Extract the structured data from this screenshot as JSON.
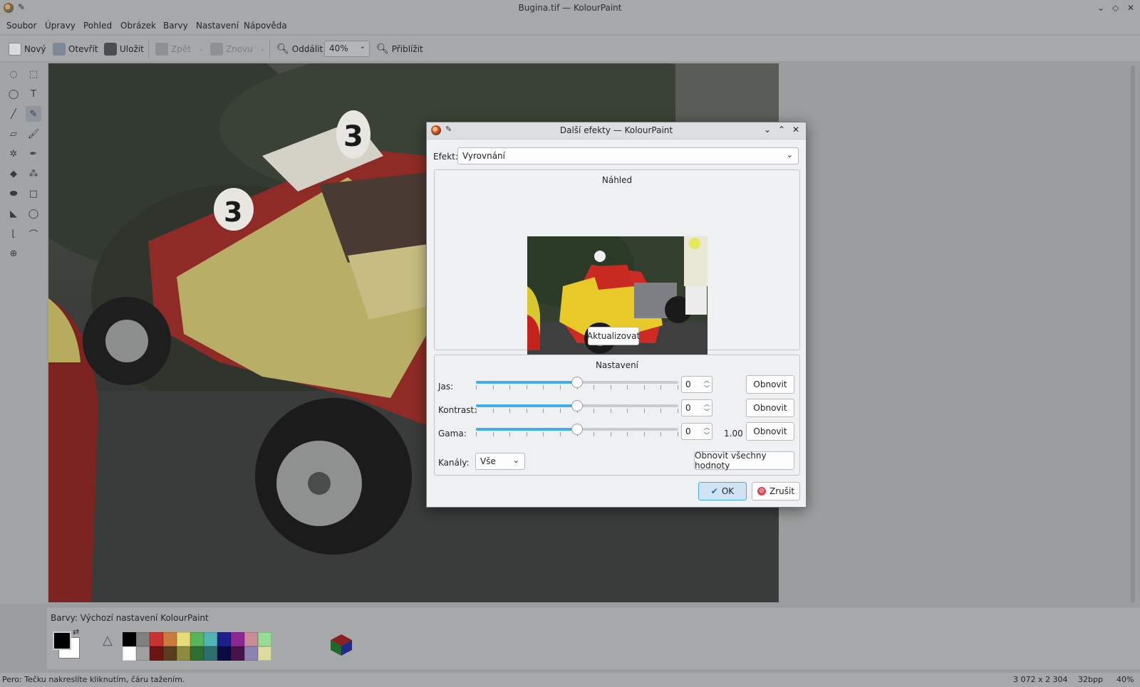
{
  "window": {
    "title": "Bugina.tif — KolourPaint"
  },
  "menu": [
    "Soubor",
    "Úpravy",
    "Pohled",
    "Obrázek",
    "Barvy",
    "Nastavení",
    "Nápověda"
  ],
  "toolbar": {
    "new": "Nový",
    "open": "Otevřít",
    "save": "Uložit",
    "undo": "Zpět",
    "redo": "Znovu",
    "zoom_out": "Oddálit",
    "zoom_value": "40%",
    "zoom_in": "Přiblížit"
  },
  "tools": [
    "free-select-icon",
    "rect-select-icon",
    "ellipse-select-icon",
    "text-icon",
    "line-icon",
    "pen-icon",
    "eraser-icon",
    "brush-icon",
    "color-eraser-icon",
    "color-picker-icon",
    "flood-fill-icon",
    "spraycan-icon",
    "ellipse-icon",
    "rectangle-icon",
    "polygon-icon",
    "rounded-rect-icon",
    "polyline-icon",
    "curve-icon",
    "zoom-icon"
  ],
  "colorbar": {
    "title": "Barvy: Výchozí nastavení KolourPaint",
    "palette_top": [
      "#000000",
      "#808080",
      "#c83232",
      "#c87d3c",
      "#e6dc78",
      "#5ab45a",
      "#50b4b4",
      "#1e1e8c",
      "#8c2896",
      "#c88c96",
      "#96dc96"
    ],
    "palette_bottom": [
      "#ffffff",
      "#a0a0a0",
      "#6e1414",
      "#5a3c1e",
      "#8c8c3c",
      "#2d6e32",
      "#2d6e6e",
      "#0a0a46",
      "#46144b",
      "#8c82b4",
      "#dcdca0"
    ]
  },
  "status": {
    "hint": "Pero: Tečku nakreslíte kliknutím, čáru tažením.",
    "dimensions": "3 072 x 2 304",
    "depth": "32bpp",
    "zoom": "40%"
  },
  "dialog": {
    "title": "Další efekty — KolourPaint",
    "effect_label": "Efekt:",
    "effect_value": "Vyrovnání",
    "preview_title": "Náhled",
    "update_button": "Aktualizovat",
    "settings_title": "Nastavení",
    "rows": [
      {
        "label": "Jas:",
        "value": "0",
        "reset": "Obnovit",
        "position": 0.5
      },
      {
        "label": "Kontrast:",
        "value": "0",
        "reset": "Obnovit",
        "position": 0.5
      },
      {
        "label": "Gama:",
        "value": "0",
        "reset": "Obnovit",
        "position": 0.5,
        "extra": "1.00"
      }
    ],
    "channels_label": "Kanály:",
    "channels_value": "Vše",
    "reset_all": "Obnovit všechny hodnoty",
    "ok": "OK",
    "cancel": "Zrušit"
  }
}
